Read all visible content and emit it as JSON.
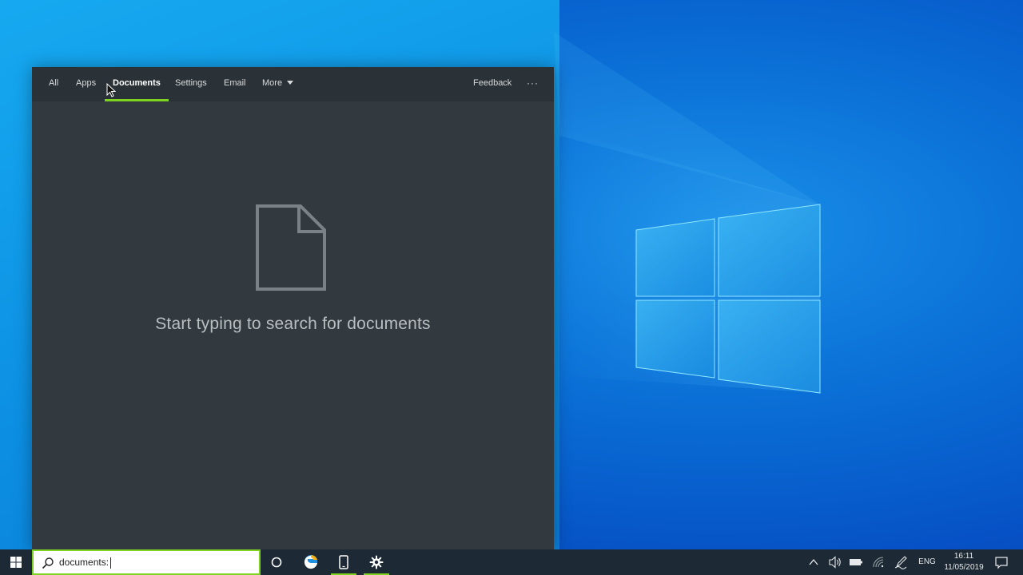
{
  "search_panel": {
    "tabs": [
      {
        "label": "All",
        "active": false
      },
      {
        "label": "Apps",
        "active": false
      },
      {
        "label": "Documents",
        "active": true
      },
      {
        "label": "Settings",
        "active": false
      },
      {
        "label": "Email",
        "active": false
      },
      {
        "label": "More",
        "active": false
      }
    ],
    "feedback_label": "Feedback",
    "options_label": "···",
    "empty_state_icon": "document-icon",
    "empty_state_message": "Start typing to search for documents"
  },
  "taskbar": {
    "search_value": "documents:",
    "pinned_icons": [
      "cortana-icon",
      "edge-icon",
      "phone-icon",
      "settings-gear-icon"
    ],
    "tray": {
      "language": "ENG",
      "time": "16:11",
      "date": "11/05/2019"
    }
  },
  "colors": {
    "accent": "#7ed321",
    "panel_bg": "#323a40",
    "tabbar_bg": "#2b3237",
    "taskbar_bg": "#1d2a35"
  }
}
